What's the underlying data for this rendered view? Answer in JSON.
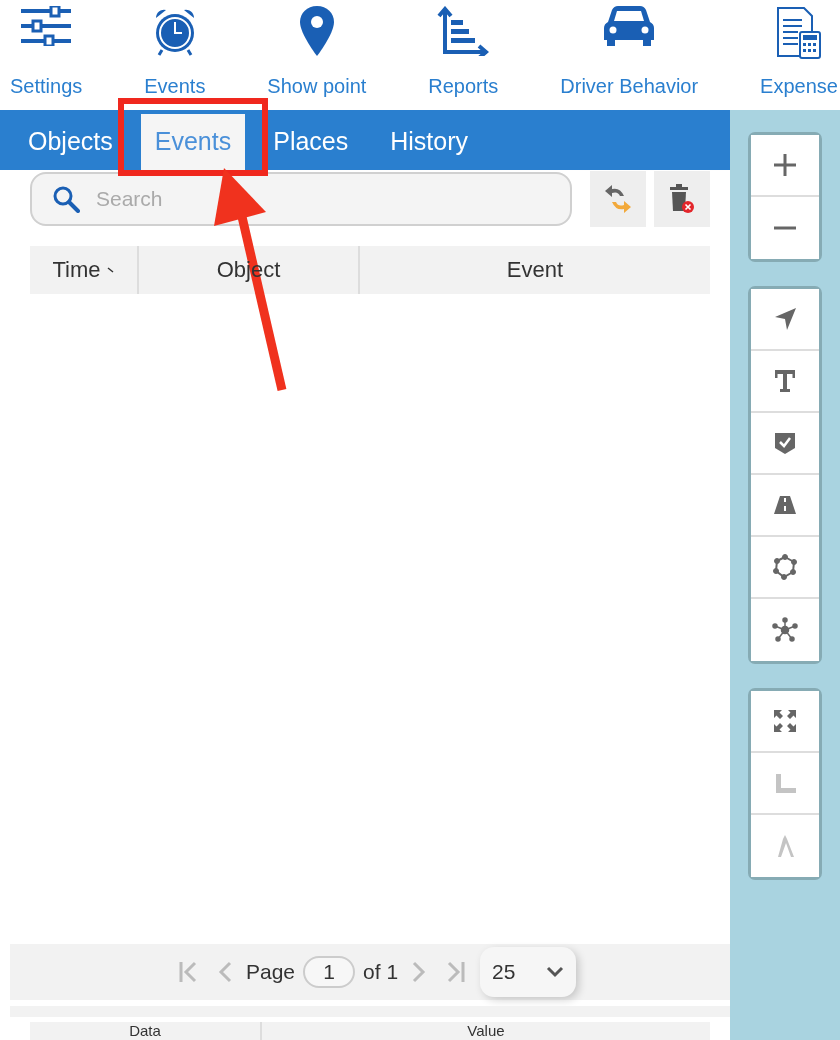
{
  "toolbar": [
    {
      "label": "Settings"
    },
    {
      "label": "Events"
    },
    {
      "label": "Show point"
    },
    {
      "label": "Reports"
    },
    {
      "label": "Driver Behavior"
    },
    {
      "label": "Expense"
    }
  ],
  "tabs": [
    {
      "label": "Objects",
      "selected": false
    },
    {
      "label": "Events",
      "selected": true
    },
    {
      "label": "Places",
      "selected": false
    },
    {
      "label": "History",
      "selected": false
    }
  ],
  "search": {
    "placeholder": "Search"
  },
  "events_table": {
    "columns": [
      {
        "label": "Time",
        "sorted": true
      },
      {
        "label": "Object",
        "sorted": false
      },
      {
        "label": "Event",
        "sorted": false
      }
    ]
  },
  "pagination": {
    "page_label": "Page",
    "page": "1",
    "of": "of 1",
    "per_page": "25"
  },
  "details_table": {
    "columns": [
      "Data",
      "Value"
    ]
  },
  "map_tools": [
    {
      "disabled": false
    },
    {
      "disabled": false
    },
    {
      "disabled": false
    },
    {
      "disabled": false
    },
    {
      "disabled": false
    },
    {
      "disabled": false
    },
    {
      "disabled": false
    },
    {
      "disabled": false
    },
    {
      "disabled": false
    },
    {
      "disabled": true
    },
    {
      "disabled": true
    }
  ]
}
